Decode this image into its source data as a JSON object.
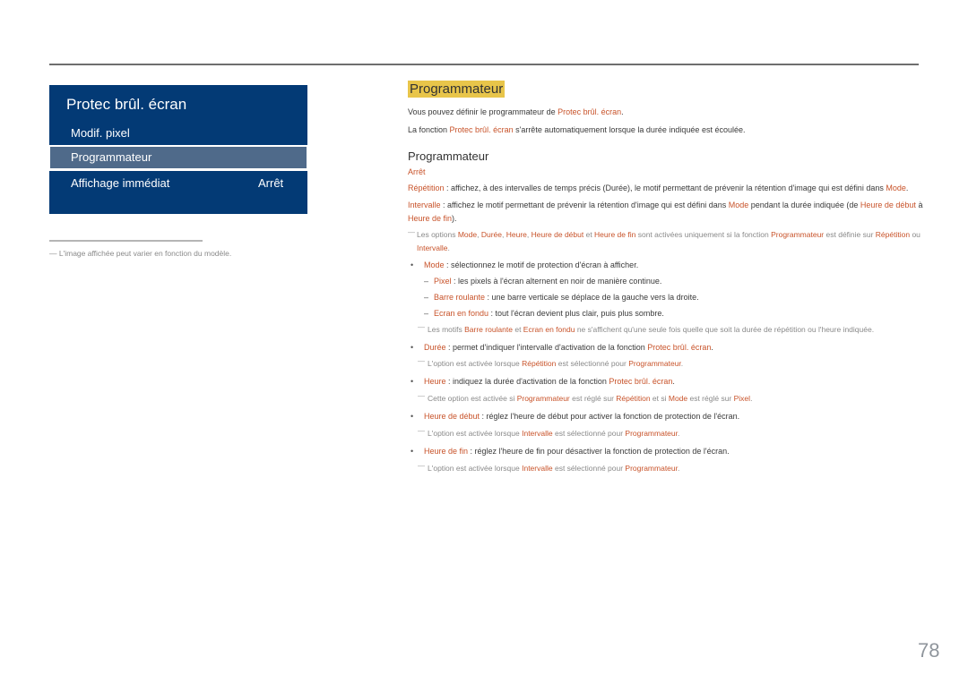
{
  "menu": {
    "title": "Protec brûl. écran",
    "items": [
      {
        "label": "Modif. pixel",
        "value": ""
      },
      {
        "label": "Programmateur",
        "value": "",
        "selected": true
      },
      {
        "label": "Affichage immédiat",
        "value": "Arrêt"
      }
    ],
    "colors": {
      "panel": "#033a75",
      "selected": "#4f6a8a"
    }
  },
  "footnote": "L'image affichée peut varier en fonction du modèle.",
  "section": {
    "title": "Programmateur",
    "intro1": {
      "a": "Vous pouvez définir le programmateur de ",
      "b": "Protec brûl. écran",
      "c": "."
    },
    "intro2": {
      "a": "La fonction ",
      "b": "Protec brûl. écran",
      "c": " s'arrête automatiquement lorsque la durée indiquée est écoulée."
    },
    "subheading": "Programmateur",
    "option_off": "Arrêt",
    "repetition": {
      "term": "Répétition",
      "a": " : affichez, à des intervalles de temps précis (Durée), le motif permettant de prévenir la rétention d'image qui est défini dans ",
      "b": "Mode",
      "c": "."
    },
    "intervalle": {
      "term": "Intervalle",
      "a": " : affichez le motif permettant de prévenir la rétention d'image qui est défini dans ",
      "b": "Mode",
      "c": " pendant la durée indiquée (de ",
      "d": "Heure de début",
      "e": " à ",
      "f": "Heure de fin",
      "g": ")."
    },
    "note_options": {
      "a": "Les options ",
      "mode": "Mode",
      "s1": ", ",
      "duree": "Durée",
      "s2": ", ",
      "heure": "Heure",
      "s3": ", ",
      "debut": "Heure de début",
      "s4": " et ",
      "fin": "Heure de fin",
      "s5": " sont activées uniquement si la fonction ",
      "prog": "Programmateur",
      "s6": " est définie sur ",
      "rep": "Répétition",
      "s7": " ou ",
      "int": "Intervalle",
      "s8": "."
    },
    "mode_bullet": {
      "term": "Mode",
      "text": " : sélectionnez le motif de protection d'écran à afficher."
    },
    "mode_subs": [
      {
        "term": "Pixel",
        "text": " : les pixels à l'écran alternent en noir de manière continue."
      },
      {
        "term": "Barre roulante",
        "text": " : une barre verticale se déplace de la gauche vers la droite."
      },
      {
        "term": "Ecran en fondu",
        "text": " : tout l'écran devient plus clair, puis plus sombre."
      }
    ],
    "note_motifs": {
      "a": "Les motifs ",
      "b": "Barre roulante",
      "c": " et ",
      "d": "Ecran en fondu",
      "e": " ne s'affichent qu'une seule fois quelle que soit la durée de répétition ou l'heure indiquée."
    },
    "duree_bullet": {
      "term": "Durée",
      "text": " : permet d'indiquer l'intervalle d'activation de la fonction ",
      "link": "Protec brûl. écran",
      "end": "."
    },
    "note_duree": {
      "a": "L'option est activée lorsque ",
      "b": "Répétition",
      "c": " est sélectionné pour ",
      "d": "Programmateur",
      "e": "."
    },
    "heure_bullet": {
      "term": "Heure",
      "text": " : indiquez la durée d'activation de la fonction ",
      "link": "Protec brûl. écran",
      "end": "."
    },
    "note_heure": {
      "a": "Cette option est activée si ",
      "b": "Programmateur",
      "c": " est réglé sur ",
      "d": "Répétition",
      "e": " et si ",
      "f": "Mode",
      "g": " est réglé sur ",
      "h": "Pixel",
      "i": "."
    },
    "debut_bullet": {
      "term": "Heure de début",
      "text": " : réglez l'heure de début pour activer la fonction de protection de l'écran."
    },
    "note_debut": {
      "a": "L'option est activée lorsque ",
      "b": "Intervalle",
      "c": " est sélectionné pour ",
      "d": "Programmateur",
      "e": "."
    },
    "fin_bullet": {
      "term": "Heure de fin",
      "text": " : réglez l'heure de fin pour désactiver la fonction de protection de l'écran."
    },
    "note_fin": {
      "a": "L'option est activée lorsque ",
      "b": "Intervalle",
      "c": " est sélectionné pour ",
      "d": "Programmateur",
      "e": "."
    }
  },
  "colors": {
    "highlight_term": "#c8532a",
    "heading_highlight": "#e8c54a"
  },
  "page_number": "78"
}
